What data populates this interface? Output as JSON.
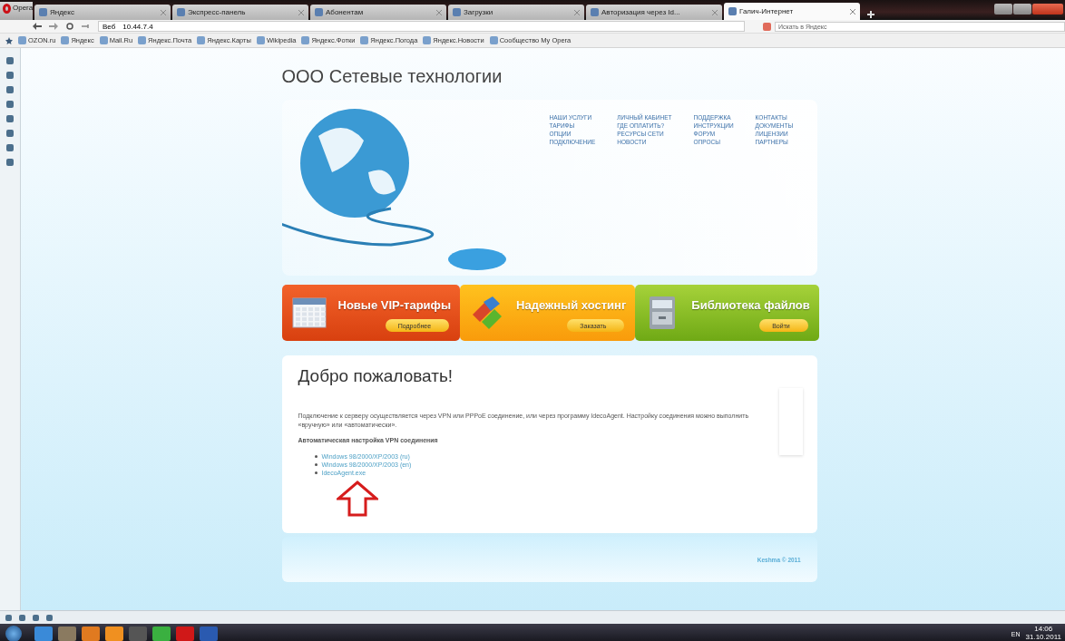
{
  "browser": {
    "menu_label": "Opera",
    "tabs": [
      {
        "label": "Яндекс",
        "selected": false
      },
      {
        "label": "Экспресс-панель",
        "selected": false
      },
      {
        "label": "Абонентам",
        "selected": false
      },
      {
        "label": "Загрузки",
        "selected": false
      },
      {
        "label": "Авторизация через Id...",
        "selected": false
      },
      {
        "label": "Галич-Интернет",
        "selected": true
      }
    ],
    "address_prefix": "Веб",
    "address": "10.44.7.4",
    "search_placeholder": "Искать в Яндекс",
    "bookmarks": [
      "OZON.ru",
      "Яндекс",
      "Mail.Ru",
      "Яндекс.Почта",
      "Яндекс.Карты",
      "Wikipedia",
      "Яндекс.Фотки",
      "Яндекс.Погода",
      "Яндекс.Новости",
      "Сообщество My Opera"
    ]
  },
  "site": {
    "title": "ООО Сетевые технологии",
    "menu_columns": [
      [
        "НАШИ УСЛУГИ",
        "ТАРИФЫ",
        "ОПЦИИ",
        "ПОДКЛЮЧЕНИЕ"
      ],
      [
        "ЛИЧНЫЙ КАБИНЕТ",
        "ГДЕ ОПЛАТИТЬ?",
        "РЕСУРСЫ СЕТИ",
        "НОВОСТИ"
      ],
      [
        "ПОДДЕРЖКА",
        "ИНСТРУКЦИИ",
        "ФОРУМ",
        "ОПРОСЫ"
      ],
      [
        "КОНТАКТЫ",
        "ДОКУМЕНТЫ",
        "ЛИЦЕНЗИИ",
        "ПАРТНЕРЫ"
      ]
    ],
    "banners": [
      {
        "kind": "calendar",
        "title": "Новые VIP-тарифы",
        "button": "Подробнее"
      },
      {
        "kind": "blocks",
        "title": "Надежный хостинг",
        "button": "Заказать"
      },
      {
        "kind": "cabinet",
        "title": "Библиотека файлов",
        "button": "Войти"
      }
    ],
    "heading": "Добро пожаловать!",
    "intro": "Подключение к серверу осуществляется через VPN или PPPoE соединение, или через программу IdecoAgent. Настройку соединения можно выполнить «вручную» или «автоматически».",
    "subheading": "Автоматическая настройка VPN соединения",
    "links": [
      "Windows 98/2000/XP/2003 (ru)",
      "Windows 98/2000/XP/2003 (en)",
      "IdecoAgent.exe"
    ],
    "footer": "Keshma © 2011"
  },
  "taskbar": {
    "language": "EN",
    "time": "14:06",
    "date": "31.10.2011"
  }
}
